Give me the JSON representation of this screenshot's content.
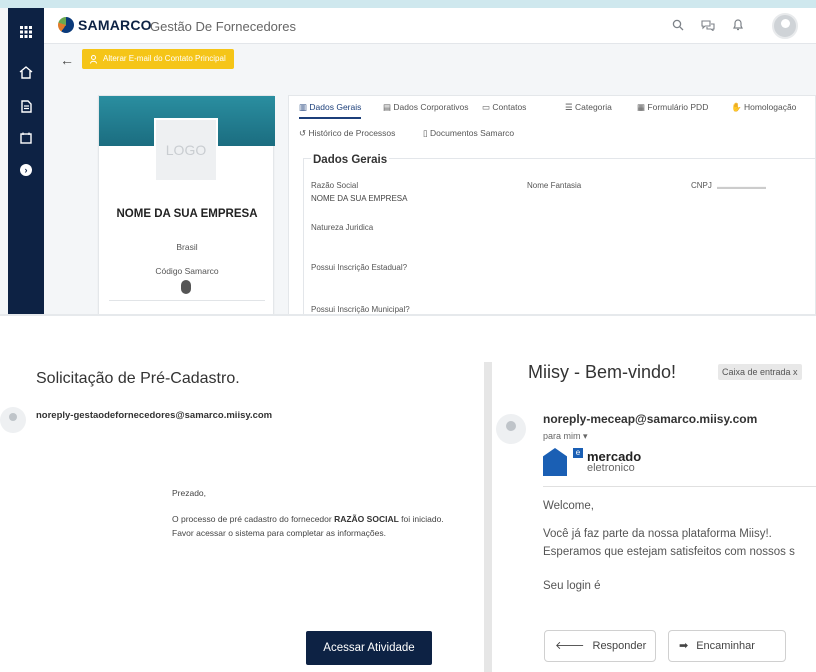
{
  "app": {
    "brand": "SAMARCO",
    "title": "Gestão De Fornecedores",
    "alter_button": "Alterar E-mail do Contato Principal"
  },
  "company_card": {
    "logo_placeholder": "LOGO",
    "name": "NOME DA SUA EMPRESA",
    "country": "Brasil",
    "code_label": "Código Samarco"
  },
  "tabs": [
    {
      "label": "Dados Gerais",
      "icon": "building-icon"
    },
    {
      "label": "Dados Corporativos",
      "icon": "table-icon"
    },
    {
      "label": "Contatos",
      "icon": "contact-card-icon"
    },
    {
      "label": "Categoria",
      "icon": "list-icon"
    },
    {
      "label": "Formulário PDD",
      "icon": "form-icon"
    },
    {
      "label": "Homologação",
      "icon": "handshake-icon"
    },
    {
      "label": "Histórico de Processos",
      "icon": "history-icon"
    },
    {
      "label": "Documentos Samarco",
      "icon": "document-icon"
    }
  ],
  "dados_gerais": {
    "legend": "Dados Gerais",
    "razao_social_label": "Razão Social",
    "razao_social_value": "NOME DA SUA EMPRESA",
    "nome_fantasia_label": "Nome Fantasia",
    "cnpj_label": "CNPJ",
    "natureza_label": "Natureza Juridica",
    "inscricao_estadual_label": "Possui Inscrição Estadual?",
    "inscricao_municipal_label": "Possui Inscrição Municipal?"
  },
  "email1": {
    "subject": "Solicitação de Pré-Cadastro.",
    "from": "noreply-gestaodefornecedores@samarco.miisy.com",
    "greeting": "Prezado,",
    "body_prefix": "O processo de pré cadastro do fornecedor ",
    "body_bold": "RAZÃO SOCIAL",
    "body_suffix": " foi iniciado.",
    "body_line2": "Favor acessar o sistema para completar as informações.",
    "action": "Acessar Atividade"
  },
  "email2": {
    "subject": "Miisy - Bem-vindo!",
    "inbox_chip": "Caixa de entrada  x",
    "from": "noreply-meceap@samarco.miisy.com",
    "to": "para mim",
    "brand_line1": "mercado",
    "brand_line2": "eletronico",
    "welcome": "Welcome,",
    "line1": "Você já faz parte da nossa plataforma Miisy!.",
    "line2": "Esperamos que estejam satisfeitos com nossos s",
    "login": "Seu login é",
    "reply": "Responder",
    "forward": "Encaminhar"
  }
}
